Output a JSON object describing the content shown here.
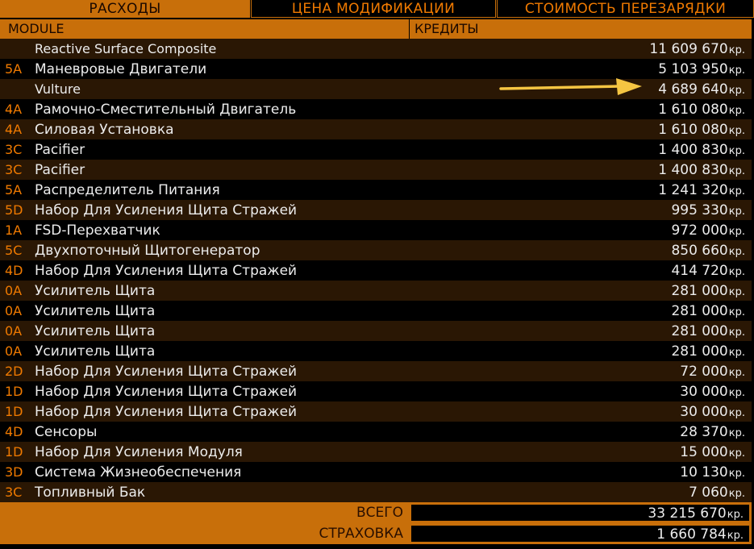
{
  "tabs": [
    {
      "label": "РАСХОДЫ"
    },
    {
      "label": "ЦЕНА МОДИФИКАЦИИ"
    },
    {
      "label": "СТОИМОСТЬ ПЕРЕЗАРЯДКИ"
    }
  ],
  "header": {
    "module": "MODULE",
    "credits": "КРЕДИТЫ"
  },
  "unit": "кр.",
  "rows": [
    {
      "cls": "",
      "name": "Reactive Surface Composite",
      "price": "11 609 670"
    },
    {
      "cls": "5A",
      "name": "Маневровые Двигатели",
      "price": "5 103 950"
    },
    {
      "cls": "",
      "name": "Vulture",
      "price": "4 689 640"
    },
    {
      "cls": "4A",
      "name": "Рамочно-Сместительный Двигатель",
      "price": "1 610 080"
    },
    {
      "cls": "4A",
      "name": "Силовая Установка",
      "price": "1 610 080"
    },
    {
      "cls": "3C",
      "name": "Pacifier",
      "price": "1 400 830"
    },
    {
      "cls": "3C",
      "name": "Pacifier",
      "price": "1 400 830"
    },
    {
      "cls": "5A",
      "name": "Распределитель Питания",
      "price": "1 241 320"
    },
    {
      "cls": "5D",
      "name": "Набор Для Усиления Щита Стражей",
      "price": "995 330"
    },
    {
      "cls": "1A",
      "name": "FSD-Перехватчик",
      "price": "972 000"
    },
    {
      "cls": "5C",
      "name": "Двухпоточный Щитогенератор",
      "price": "850 660"
    },
    {
      "cls": "4D",
      "name": "Набор Для Усиления Щита Стражей",
      "price": "414 720"
    },
    {
      "cls": "0A",
      "name": "Усилитель Щита",
      "price": "281 000"
    },
    {
      "cls": "0A",
      "name": "Усилитель Щита",
      "price": "281 000"
    },
    {
      "cls": "0A",
      "name": "Усилитель Щита",
      "price": "281 000"
    },
    {
      "cls": "0A",
      "name": "Усилитель Щита",
      "price": "281 000"
    },
    {
      "cls": "2D",
      "name": "Набор Для Усиления Щита Стражей",
      "price": "72 000"
    },
    {
      "cls": "1D",
      "name": "Набор Для Усиления Щита Стражей",
      "price": "30 000"
    },
    {
      "cls": "1D",
      "name": "Набор Для Усиления Щита Стражей",
      "price": "30 000"
    },
    {
      "cls": "4D",
      "name": "Сенсоры",
      "price": "28 370"
    },
    {
      "cls": "1D",
      "name": "Набор Для Усиления Модуля",
      "price": "15 000"
    },
    {
      "cls": "3D",
      "name": "Система Жизнеобеспечения",
      "price": "10 130"
    },
    {
      "cls": "3C",
      "name": "Топливный Бак",
      "price": "7 060"
    }
  ],
  "totals": {
    "total_label": "ВСЕГО",
    "total_value": "33 215 670",
    "insurance_label": "СТРАХОВКА",
    "insurance_value": "1 660 784"
  },
  "colors": {
    "accent": "#c86f0a",
    "class_text": "#f07a00",
    "row_odd": "#2a1704",
    "row_even": "#000000",
    "arrow": "#f5c542"
  },
  "icons": {
    "annotation": "arrow-right-icon"
  }
}
